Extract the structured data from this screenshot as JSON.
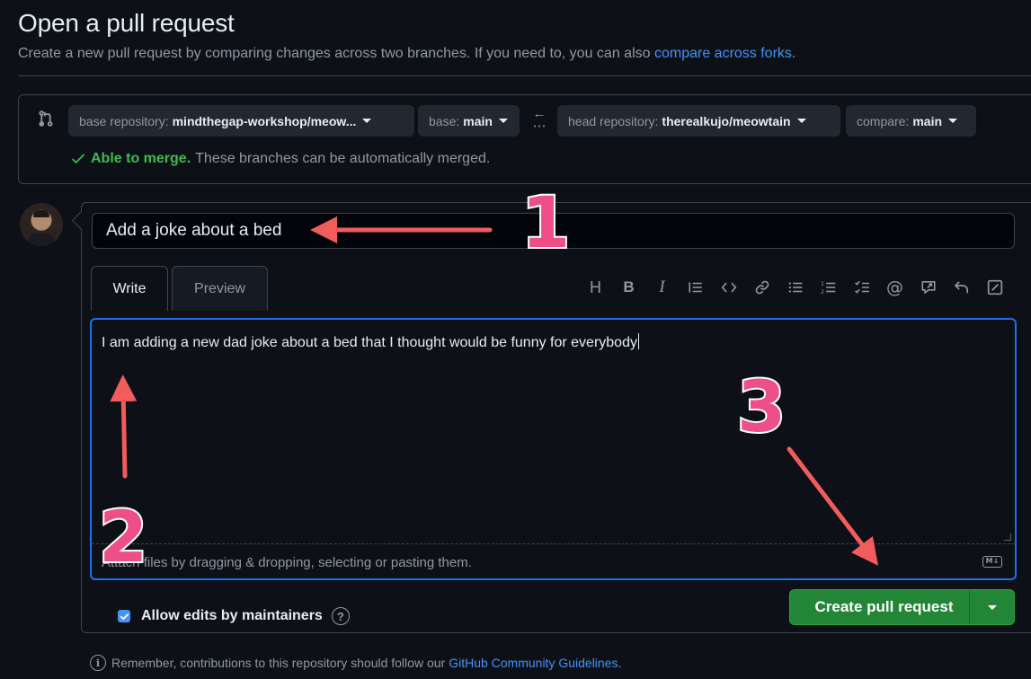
{
  "page": {
    "title": "Open a pull request",
    "subtitle_text": "Create a new pull request by comparing changes across two branches. If you need to, you can also ",
    "subtitle_link": "compare across forks",
    "subtitle_end": "."
  },
  "compare": {
    "base_repo_label": "base repository:",
    "base_repo_value": "mindthegap-workshop/meow...",
    "base_label": "base:",
    "base_value": "main",
    "head_repo_label": "head repository:",
    "head_repo_value": "therealkujo/meowtain",
    "compare_label": "compare:",
    "compare_value": "main",
    "merge_ok": "Able to merge.",
    "merge_text": "These branches can be automatically merged."
  },
  "form": {
    "title_value": "Add a joke about a bed",
    "tabs": [
      "Write",
      "Preview"
    ],
    "toolbar_icons": [
      "heading-icon",
      "bold-icon",
      "italic-icon",
      "quote-icon",
      "code-icon",
      "link-icon",
      "bullet-list-icon",
      "numbered-list-icon",
      "task-list-icon",
      "mention-icon",
      "reference-icon",
      "undo-icon",
      "fullscreen-icon"
    ],
    "body_value": "I am adding a new dad joke about a bed that I thought would be funny for everybody",
    "attach_text": "Attach files by dragging & dropping, selecting or pasting them.",
    "markdown_badge": "M↓",
    "allow_edits_label": "Allow edits by maintainers",
    "allow_edits_checked": true,
    "help_glyph": "?",
    "create_button": "Create pull request"
  },
  "footer": {
    "text": "Remember, contributions to this repository should follow our",
    "link": "GitHub Community Guidelines",
    "end": "."
  },
  "annotations": {
    "one": "1",
    "two": "2",
    "three": "3",
    "color": "#ee4f86"
  },
  "colors": {
    "accent": "#4493f8",
    "success": "#3fb950",
    "primary_button": "#238636",
    "focus_border": "#1f6feb"
  }
}
